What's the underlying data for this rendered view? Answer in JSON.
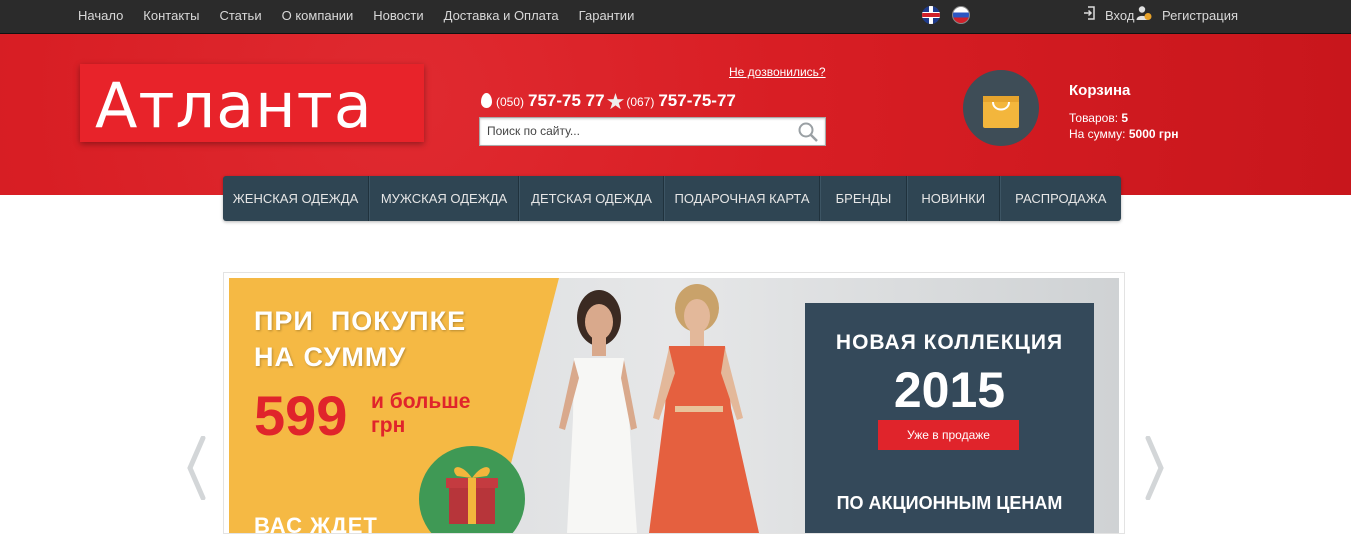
{
  "topbar": {
    "nav": [
      "Начало",
      "Контакты",
      "Статьи",
      "О компании",
      "Новости",
      "Доставка и Оплата",
      "Гарантии"
    ],
    "languages": [
      "en-flag-icon",
      "ru-flag-icon"
    ],
    "login_label": "Вход",
    "register_label": "Регистрация"
  },
  "header": {
    "logo_text": "Атланта",
    "redial_link": "Не дозвонились?",
    "phone1_code": "(050)",
    "phone1_number": "757-75 77",
    "phone2_code": "(067)",
    "phone2_number": "757-75-77",
    "search_placeholder": "Поиск по сайту...",
    "cart": {
      "title": "Корзина",
      "items_label": "Товаров:",
      "items_value": "5",
      "sum_label": "На сумму:",
      "sum_value": "5000 грн"
    }
  },
  "mainnav": [
    "ЖЕНСКАЯ ОДЕЖДА",
    "МУЖСКАЯ ОДЕЖДА",
    "ДЕТСКАЯ ОДЕЖДА",
    "ПОДАРОЧНАЯ КАРТА",
    "БРЕНДЫ",
    "НОВИНКИ",
    "РАСПРОДАЖА"
  ],
  "banner": {
    "promo_line1": "ПРИ  ПОКУПКЕ",
    "promo_line2": "НА СУММУ",
    "price": "599",
    "price_suffix1": "и больше",
    "price_suffix2": "грн",
    "wait_text": "ВАС ЖДЕТ",
    "collection_title": "НОВАЯ КОЛЛЕКЦИЯ",
    "collection_year": "2015",
    "sale_button": "Уже в продаже",
    "promo_prices": "ПО АКЦИОННЫМ ЦЕНАМ"
  },
  "colors": {
    "header_red": "#d81e24",
    "nav_dark": "#2f4553",
    "banner_yellow": "#f5b944",
    "banner_navy": "#34495a",
    "accent_red": "#e0242b"
  }
}
